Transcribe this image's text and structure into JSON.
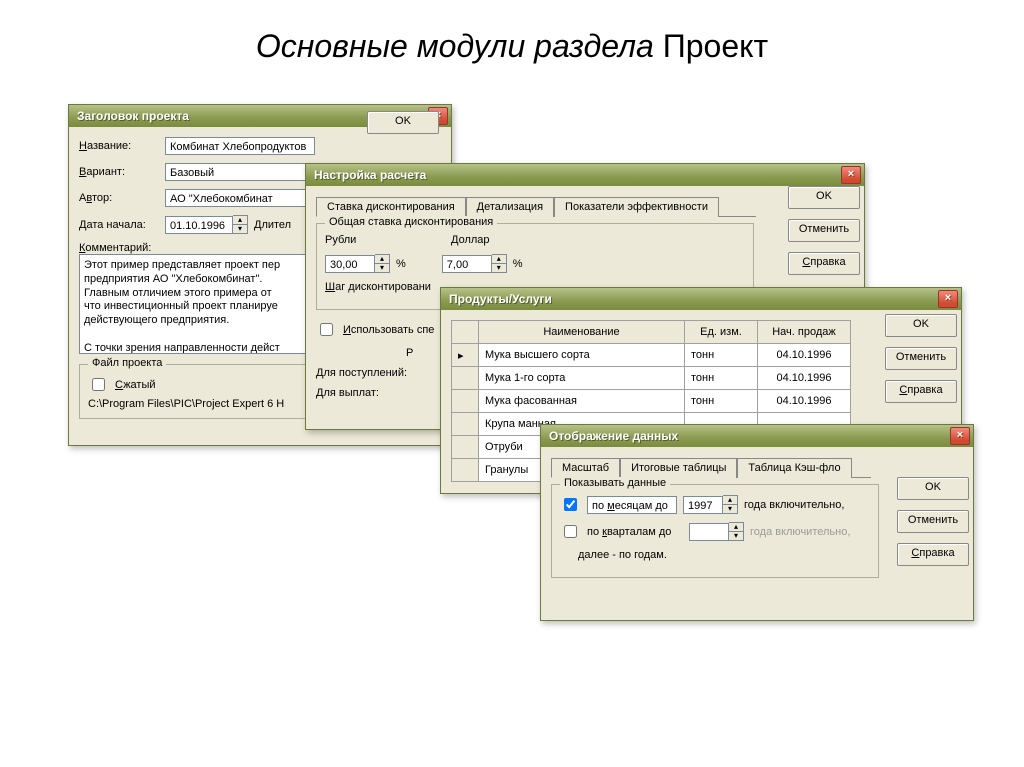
{
  "slide_title": {
    "italic": "Основные модули раздела",
    "plain": "Проект"
  },
  "win1": {
    "title": "Заголовок проекта",
    "labels": {
      "name": "Название:",
      "variant": "Вариант:",
      "author": "Автор:",
      "date": "Дата начала:",
      "duration": "Длител",
      "comment": "Комментарий:"
    },
    "values": {
      "name": "Комбинат Хлебопродуктов",
      "variant": "Базовый",
      "author": "АО \"Хлебокомбинат",
      "date": "01.10.1996"
    },
    "comment_text": "Этот пример представляет проект пер\nпредприятия АО \"Хлебокомбинат\".\nГлавным отличием этого примера от\nчто инвестиционный проект планируе\nдействующего предприятия.\n\nС точки зрения направленности дейст",
    "filebox": {
      "legend": "Файл проекта",
      "compressed": "Сжатый",
      "path": "C:\\Program Files\\PIC\\Project Expert 6 H"
    },
    "buttons": {
      "ok": "OK"
    }
  },
  "win2": {
    "title": "Настройка расчета",
    "tabs": [
      "Ставка дисконтирования",
      "Детализация",
      "Показатели эффективности"
    ],
    "group_legend": "Общая ставка дисконтирования",
    "labels": {
      "rub": "Рубли",
      "usd": "Доллар",
      "step": "Шаг дисконтировани",
      "use_spec": "Использовать спе",
      "income": "Для поступлений:",
      "expense": "Для выплат:",
      "pct": "%"
    },
    "values": {
      "rub": "30,00",
      "usd": "7,00"
    },
    "buttons": {
      "ok": "OK",
      "cancel": "Отменить",
      "help": "Справка"
    }
  },
  "win3": {
    "title": "Продукты/Услуги",
    "columns": [
      "Наименование",
      "Ед. изм.",
      "Нач. продаж"
    ],
    "rows": [
      {
        "name": "Мука высшего сорта",
        "unit": "тонн",
        "date": "04.10.1996",
        "current": true
      },
      {
        "name": "Мука 1-го сорта",
        "unit": "тонн",
        "date": "04.10.1996"
      },
      {
        "name": "Мука фасованная",
        "unit": "тонн",
        "date": "04.10.1996"
      },
      {
        "name": "Крупа манная",
        "unit": "",
        "date": ""
      },
      {
        "name": "Отруби",
        "unit": "",
        "date": ""
      },
      {
        "name": "Гранулы",
        "unit": "",
        "date": ""
      }
    ],
    "buttons": {
      "ok": "OK",
      "cancel": "Отменить",
      "help": "Справка"
    }
  },
  "win4": {
    "title": "Отображение данных",
    "tabs": [
      "Масштаб",
      "Итоговые таблицы",
      "Таблица Кэш-фло"
    ],
    "group_legend": "Показывать данные",
    "labels": {
      "by_month": "по месяцам до",
      "by_quarter": "по кварталам до",
      "year_incl": "года включительно,",
      "further": "далее - по годам."
    },
    "values": {
      "year": "1997"
    },
    "buttons": {
      "ok": "OK",
      "cancel": "Отменить",
      "help": "Справка"
    }
  }
}
